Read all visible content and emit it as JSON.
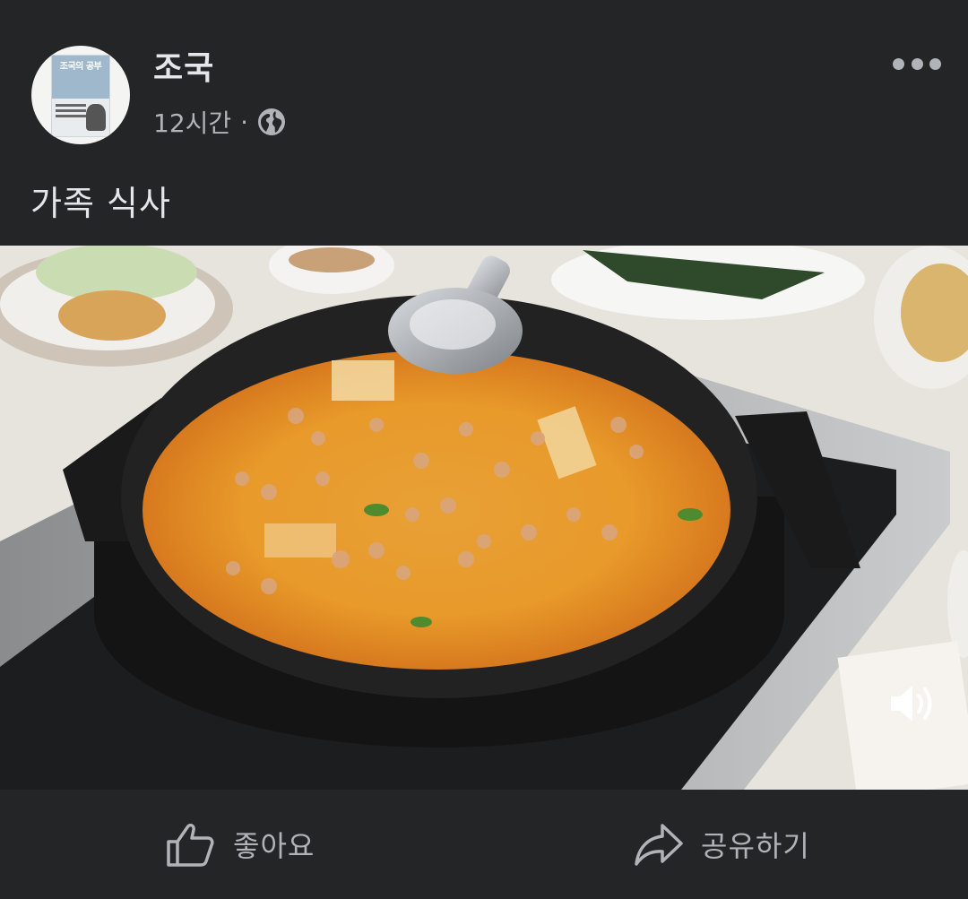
{
  "post": {
    "author_name": "조국",
    "timestamp": "12시간",
    "separator": "·",
    "privacy_icon": "globe-icon",
    "more_icon": "more-options-icon",
    "caption": "가족 식사"
  },
  "avatar": {
    "book_title": "조국의 공부"
  },
  "media": {
    "type": "video",
    "sound_icon": "speaker-icon"
  },
  "actions": {
    "like_label": "좋아요",
    "like_icon": "thumbs-up-icon",
    "share_label": "공유하기",
    "share_icon": "share-arrow-icon"
  },
  "colors": {
    "background": "#242526",
    "primary_text": "#e4e6eb",
    "secondary_text": "#b0b3b8"
  }
}
